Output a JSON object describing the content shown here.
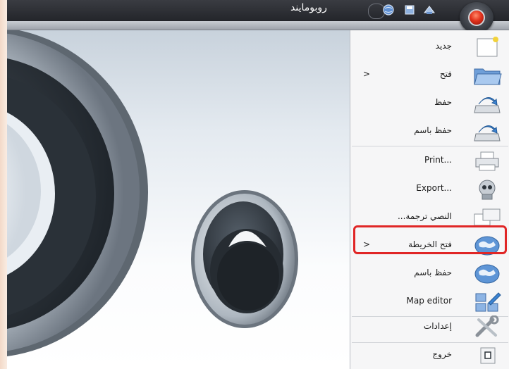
{
  "window": {
    "title": "روبومايند",
    "quick_access_icons": [
      "save-icon",
      "open-icon",
      "globe-icon"
    ],
    "app_button_icon": "robot-orb-icon"
  },
  "menu": {
    "items": [
      {
        "label": "جديد",
        "icon": "new-document-icon",
        "has_submenu": false
      },
      {
        "label": "فتح",
        "icon": "open-folder-icon",
        "has_submenu": true
      },
      {
        "label": "حفظ",
        "icon": "save-drive-icon",
        "has_submenu": false
      },
      {
        "label": "حفظ باسم",
        "icon": "save-as-drive-icon",
        "has_submenu": false
      },
      {
        "label": "Print...",
        "icon": "printer-icon",
        "has_submenu": false
      },
      {
        "label": "Export...",
        "icon": "export-robot-icon",
        "has_submenu": false
      },
      {
        "label": "النصي ترجمة...",
        "icon": "translate-windows-icon",
        "has_submenu": false
      },
      {
        "label": "فتح الخريطة",
        "icon": "open-map-globe-icon",
        "has_submenu": true,
        "highlighted": true
      },
      {
        "label": "حفظ باسم",
        "icon": "save-map-globe-icon",
        "has_submenu": false
      },
      {
        "label": "Map editor",
        "icon": "map-editor-icon",
        "has_submenu": false
      },
      {
        "label": "إعدادات",
        "icon": "settings-tools-icon",
        "has_submenu": false
      },
      {
        "label": "خروج",
        "icon": "exit-icon",
        "has_submenu": false
      }
    ],
    "submenu_arrow": ">",
    "highlight_color": "#e02626"
  },
  "colors": {
    "titlebar": "#2b2d33",
    "menu_background": "#f6f6f7",
    "highlight_border": "#e02626"
  }
}
